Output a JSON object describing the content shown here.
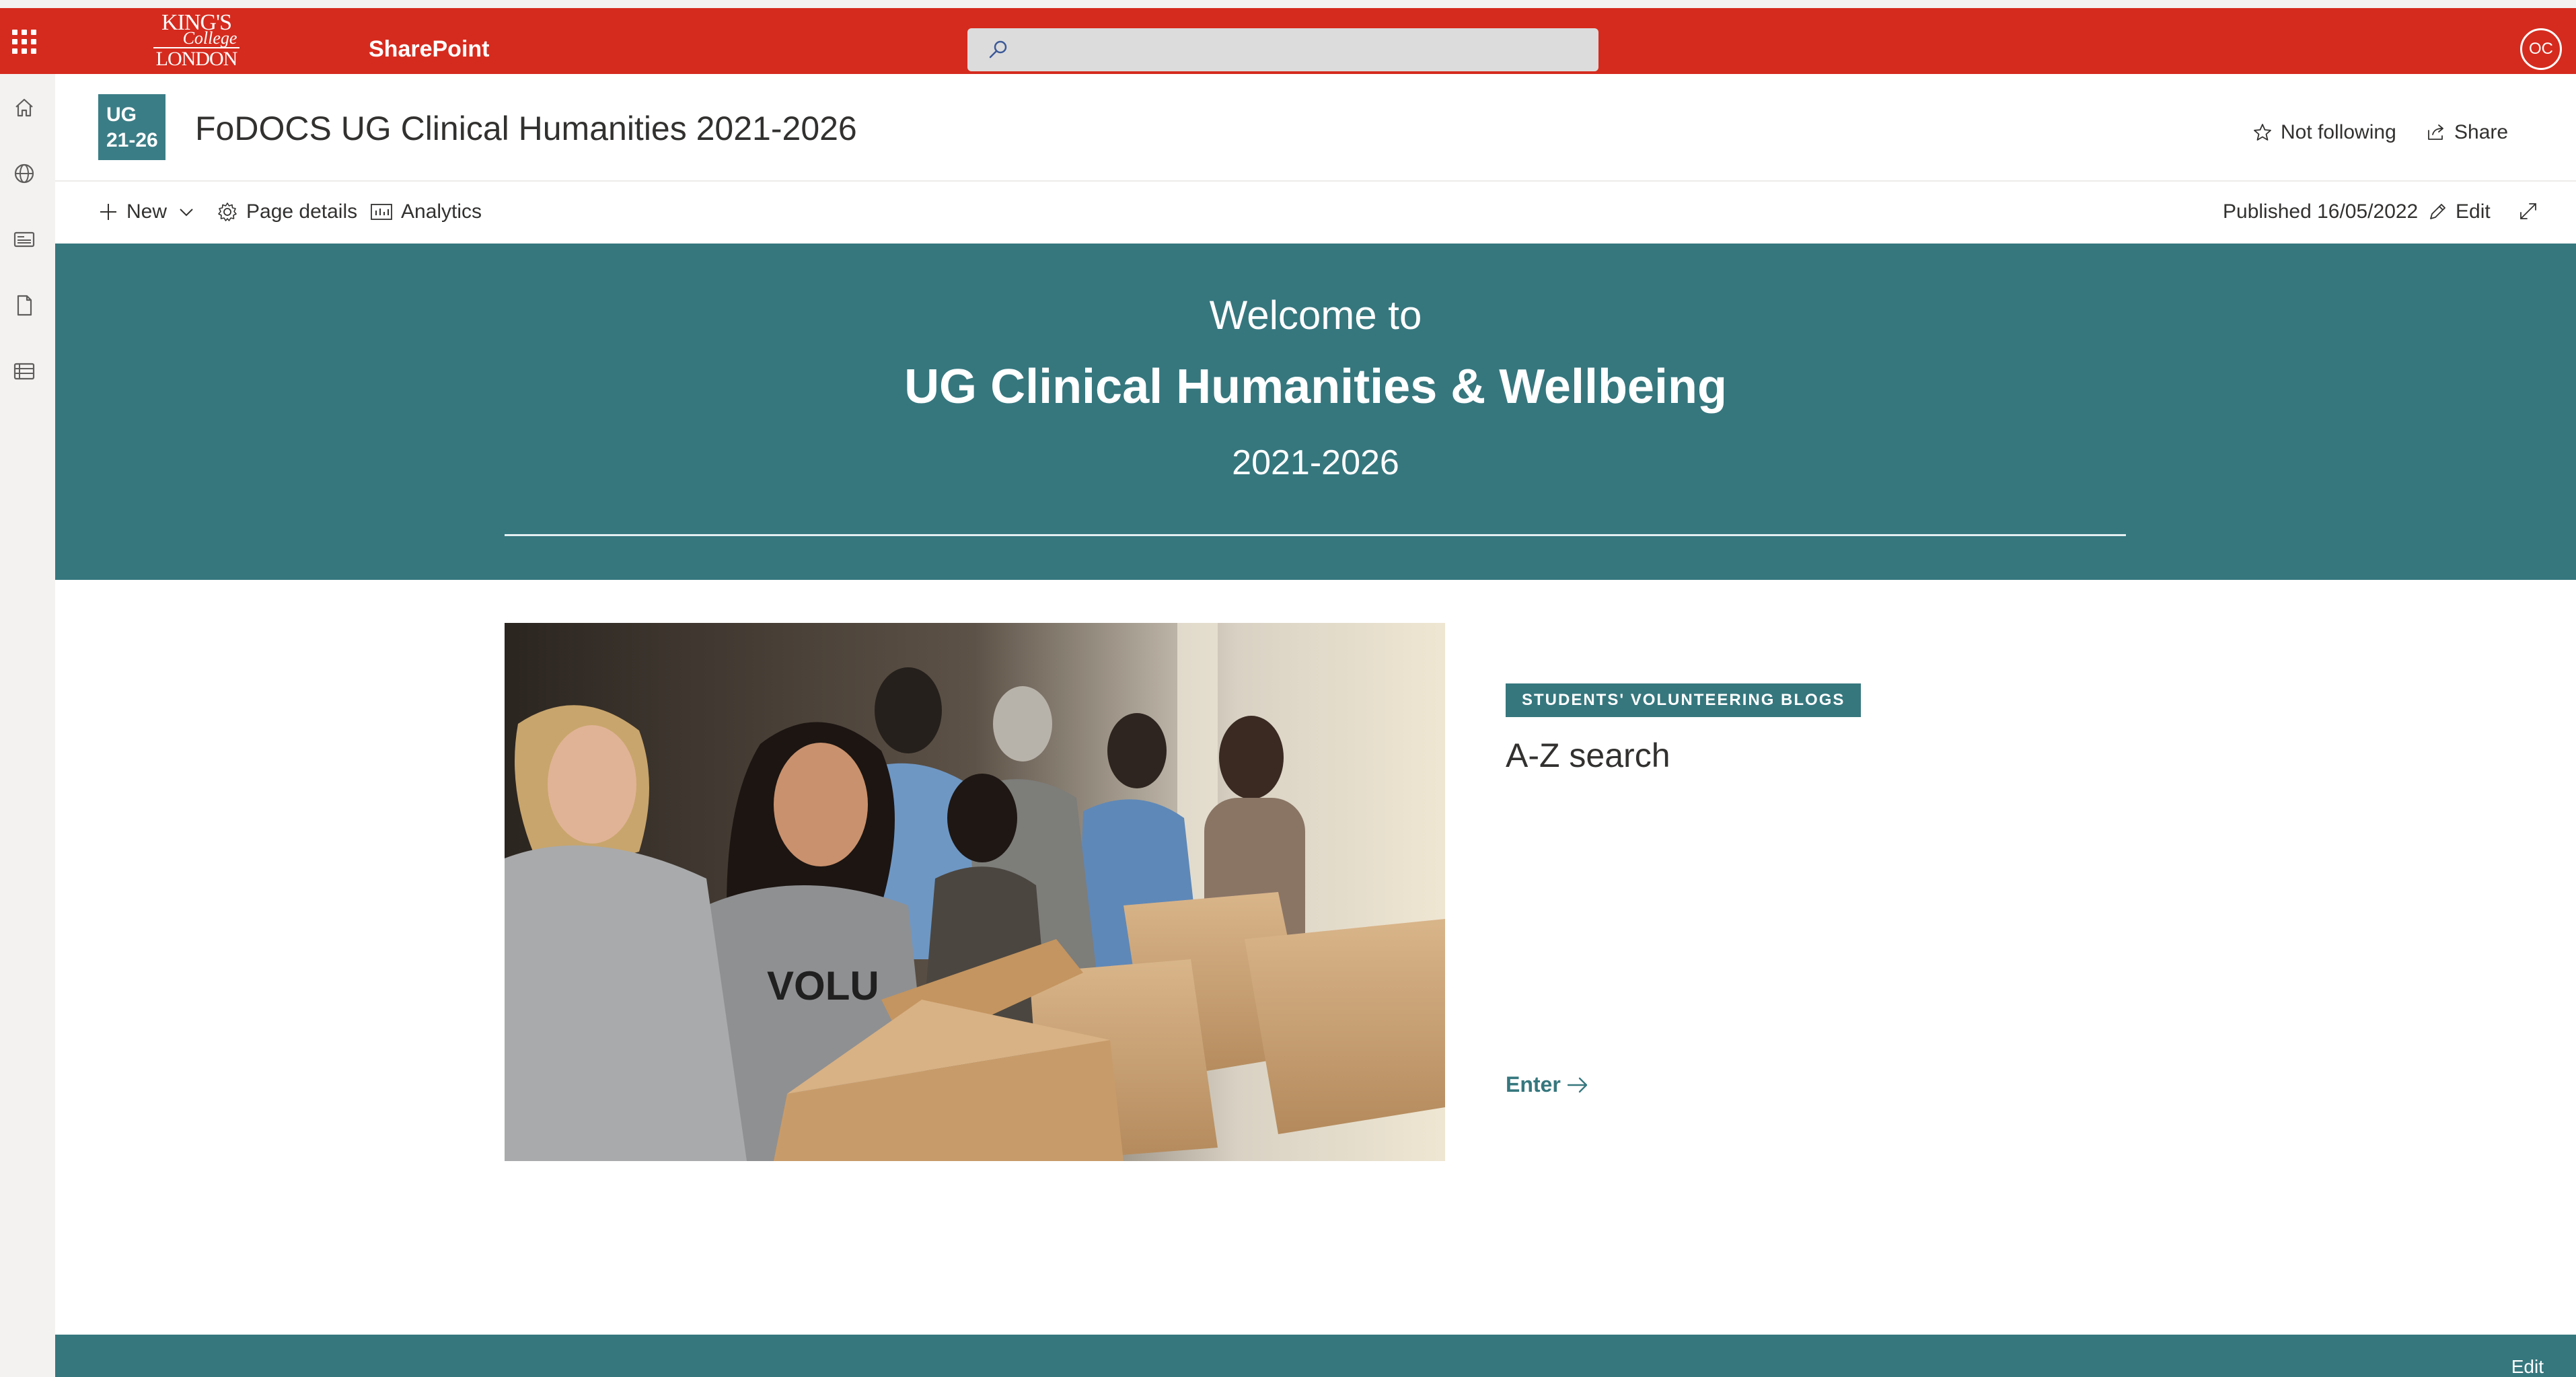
{
  "suite_bar": {
    "app_name": "SharePoint",
    "logo_text": [
      "KING'S",
      "College",
      "LONDON"
    ],
    "avatar_initials": "OC",
    "brand_color": "#d52b1e"
  },
  "site": {
    "logo_line1": "UG",
    "logo_line2": "21-26",
    "title": "FoDOCS UG Clinical Humanities 2021-2026",
    "follow_label": "Not following",
    "share_label": "Share"
  },
  "command_bar": {
    "new_label": "New",
    "page_details_label": "Page details",
    "analytics_label": "Analytics",
    "published_label": "Published 16/05/2022",
    "edit_label": "Edit"
  },
  "hero": {
    "welcome": "Welcome to",
    "title": "UG Clinical Humanities & Wellbeing",
    "years": "2021-2026",
    "color": "#36777e"
  },
  "card": {
    "tag": "STUDENTS' VOLUNTEERING BLOGS",
    "title": "A-Z search",
    "link_label": "Enter",
    "photo_text": "VOLU"
  },
  "footer": {
    "edit_label": "Edit"
  },
  "icons": {
    "left_rail": [
      "home-icon",
      "globe-icon",
      "news-icon",
      "document-icon",
      "list-icon"
    ]
  }
}
